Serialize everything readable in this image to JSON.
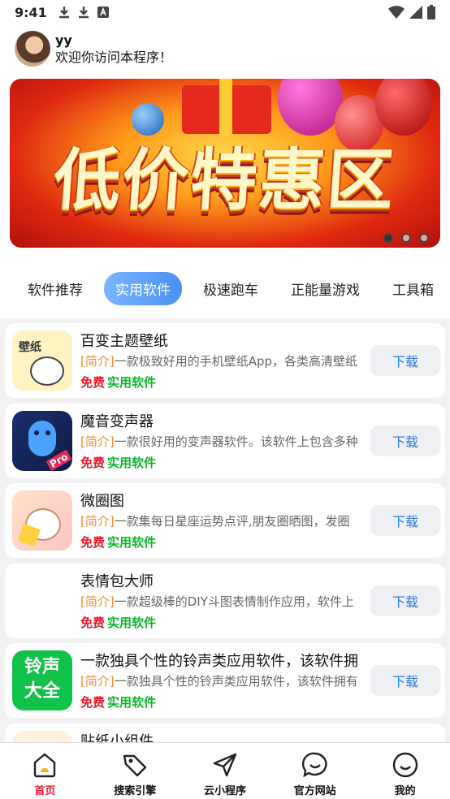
{
  "status_bar": {
    "time": "9:41"
  },
  "header": {
    "user_name": "yy",
    "welcome": "欢迎你访问本程序！"
  },
  "banner": {
    "title": "低价特惠区",
    "slides": 3,
    "active_slide": 1
  },
  "tabs": [
    {
      "label": "软件推荐",
      "active": false
    },
    {
      "label": "实用软件",
      "active": true
    },
    {
      "label": "极速跑车",
      "active": false
    },
    {
      "label": "正能量游戏",
      "active": false
    },
    {
      "label": "工具箱",
      "active": false
    }
  ],
  "apps": [
    {
      "title": "百变主题壁纸",
      "tag": "[简介]",
      "desc": "一款极致好用的手机壁纸App，各类高清壁纸",
      "free": "免费",
      "category": "实用软件",
      "button": "下载",
      "icon": "wallpaper-app-icon",
      "icon_text": "壁纸"
    },
    {
      "title": "魔音变声器",
      "tag": "[简介]",
      "desc": "一款很好用的变声器软件。该软件上包含多种",
      "free": "免费",
      "category": "实用软件",
      "button": "下载",
      "icon": "voice-changer-app-icon",
      "icon_text": "Pro"
    },
    {
      "title": "微圈图",
      "tag": "[简介]",
      "desc": "一款集每日星座运势点评,朋友圈晒图，发圈",
      "free": "免费",
      "category": "实用软件",
      "button": "下载",
      "icon": "circle-image-app-icon",
      "icon_text": ""
    },
    {
      "title": "表情包大师",
      "tag": "[简介]",
      "desc": "一款超级棒的DIY斗图表情制作应用，软件上",
      "free": "免费",
      "category": "实用软件",
      "button": "下载",
      "icon": "emoji-master-app-icon",
      "icon_text": ""
    },
    {
      "title": "一款独具个性的铃声类应用软件，该软件拥",
      "tag": "[简介]",
      "desc": "一款独具个性的铃声类应用软件，该软件拥有",
      "free": "免费",
      "category": "实用软件",
      "button": "下载",
      "icon": "ringtone-app-icon",
      "icon_text": "铃声大全"
    },
    {
      "title": "贴纸小组件",
      "tag": "",
      "desc": "",
      "free": "",
      "category": "",
      "button": "",
      "icon": "sticker-widget-app-icon",
      "icon_text": ""
    }
  ],
  "bottom_nav": [
    {
      "label": "首页",
      "icon": "home-icon",
      "active": true
    },
    {
      "label": "搜索引擎",
      "icon": "tag-icon",
      "active": false
    },
    {
      "label": "云小程序",
      "icon": "send-icon",
      "active": false
    },
    {
      "label": "官方网站",
      "icon": "chat-bubble-icon",
      "active": false
    },
    {
      "label": "我的",
      "icon": "smile-icon",
      "active": false
    }
  ],
  "colors": {
    "accent": "#4a90f5",
    "free": "#e8192c",
    "category": "#10b52a",
    "tag": "#f08c2a",
    "download_text": "#2f7de0"
  }
}
